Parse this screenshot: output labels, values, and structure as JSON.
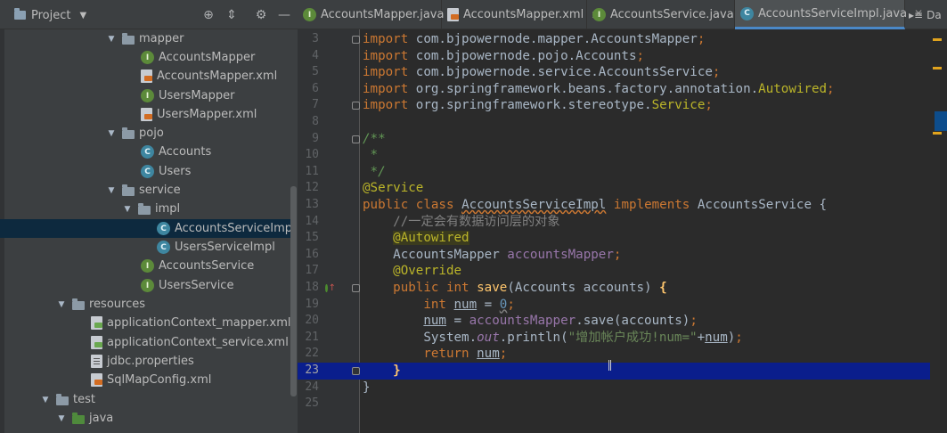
{
  "project_panel": {
    "title": "Project",
    "tree": [
      {
        "label": "mapper",
        "kind": "folder",
        "expanded": true
      },
      {
        "label": "AccountsMapper",
        "kind": "interface"
      },
      {
        "label": "AccountsMapper.xml",
        "kind": "xml"
      },
      {
        "label": "UsersMapper",
        "kind": "interface"
      },
      {
        "label": "UsersMapper.xml",
        "kind": "xml"
      },
      {
        "label": "pojo",
        "kind": "folder",
        "expanded": true
      },
      {
        "label": "Accounts",
        "kind": "class"
      },
      {
        "label": "Users",
        "kind": "class"
      },
      {
        "label": "service",
        "kind": "folder",
        "expanded": true
      },
      {
        "label": "impl",
        "kind": "folder",
        "expanded": true
      },
      {
        "label": "AccountsServiceImpl",
        "kind": "class",
        "selected": true
      },
      {
        "label": "UsersServiceImpl",
        "kind": "class"
      },
      {
        "label": "AccountsService",
        "kind": "interface"
      },
      {
        "label": "UsersService",
        "kind": "interface"
      },
      {
        "label": "resources",
        "kind": "folder",
        "expanded": true
      },
      {
        "label": "applicationContext_mapper.xml",
        "kind": "spring-xml"
      },
      {
        "label": "applicationContext_service.xml",
        "kind": "spring-xml"
      },
      {
        "label": "jdbc.properties",
        "kind": "properties"
      },
      {
        "label": "SqlMapConfig.xml",
        "kind": "xml"
      },
      {
        "label": "test",
        "kind": "folder",
        "expanded": true
      },
      {
        "label": "java",
        "kind": "folder",
        "expanded": true
      }
    ]
  },
  "tabs": [
    {
      "label": "AccountsMapper.java",
      "kind": "interface"
    },
    {
      "label": "AccountsMapper.xml",
      "kind": "xml"
    },
    {
      "label": "AccountsService.java",
      "kind": "interface"
    },
    {
      "label": "AccountsServiceImpl.java",
      "kind": "class",
      "active": true
    }
  ],
  "tab_overflow_label": "Da",
  "editor": {
    "line_numbers": [
      "3",
      "4",
      "5",
      "6",
      "7",
      "8",
      "9",
      "10",
      "11",
      "12",
      "13",
      "14",
      "15",
      "16",
      "17",
      "18",
      "19",
      "20",
      "21",
      "22",
      "23",
      "24",
      "25"
    ],
    "current_line": "23",
    "lines": {
      "l3_pkg": "com.bjpowernode.mapper.AccountsMapper",
      "l4_pkg": "com.bjpowernode.pojo.Accounts",
      "l5_pkg": "com.bjpowernode.service.AccountsService",
      "l6_pkg": "org.springframework.beans.factory.annotation.",
      "l6_cls": "Autowired",
      "l7_pkg": "org.springframework.stereotype.",
      "l7_cls": "Service",
      "kw_import": "import",
      "semicolon": ";",
      "l9": "/**",
      "l10": " *",
      "l11": " */",
      "l12": "@Service",
      "l13_public": "public",
      "l13_class": "class",
      "l13_name": "AccountsServiceImpl",
      "l13_implements": "implements",
      "l13_iface": "AccountsService {",
      "l14": "//一定会有数据访问层的对象",
      "l15": "@Autowired",
      "l16_type": "AccountsMapper ",
      "l16_field": "accountsMapper",
      "l17": "@Override",
      "l18_public": "public",
      "l18_int": "int",
      "l18_save": "save",
      "l18_params": "(Accounts accounts) ",
      "l18_brace": "{",
      "l19_int": "int",
      "l19_num": "num",
      "l19_eq": " = ",
      "l19_val": "0",
      "l20_num": "num",
      "l20_rest1": " = ",
      "l20_field": "accountsMapper",
      "l20_rest2": ".save(accounts)",
      "l21_sys": "System.",
      "l21_out": "out",
      "l21_println": ".println(",
      "l21_str": "\"增加帐户成功!num=\"",
      "l21_plus": "+",
      "l21_num": "num",
      "l21_close": ")",
      "l22_return": "return",
      "l22_num": "num",
      "l23": "}",
      "l24": "}"
    }
  },
  "colors": {
    "selection": "#0d293e",
    "current_line": "#0a1e8c",
    "keyword": "#cc7832",
    "annotation": "#bbb529",
    "field": "#9876aa",
    "string": "#6a8759",
    "number": "#6897bb",
    "comment": "#629755"
  }
}
